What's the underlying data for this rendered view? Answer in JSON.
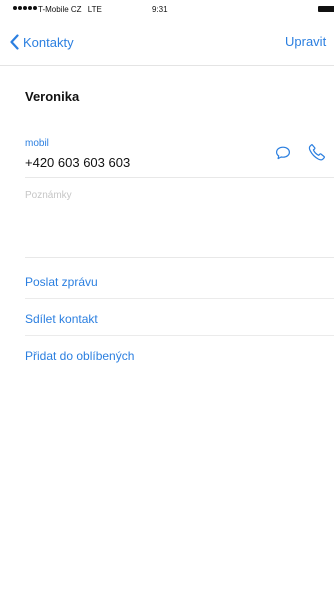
{
  "status_bar": {
    "carrier": "T-Mobile CZ",
    "network": "LTE",
    "time": "9:31"
  },
  "nav": {
    "back_label": "Kontakty",
    "edit_label": "Upravit"
  },
  "contact": {
    "name": "Veronika",
    "phone_label": "mobil",
    "phone_number": "+420 603 603 603",
    "notes_placeholder": "Poznámky"
  },
  "actions": {
    "send_message": "Poslat zprávu",
    "share_contact": "Sdílet kontakt",
    "add_favorites": "Přidat do oblíbených"
  },
  "colors": {
    "accent": "#2b7fe0",
    "placeholder": "#c6c6c6",
    "separator": "#e8e8e8"
  }
}
